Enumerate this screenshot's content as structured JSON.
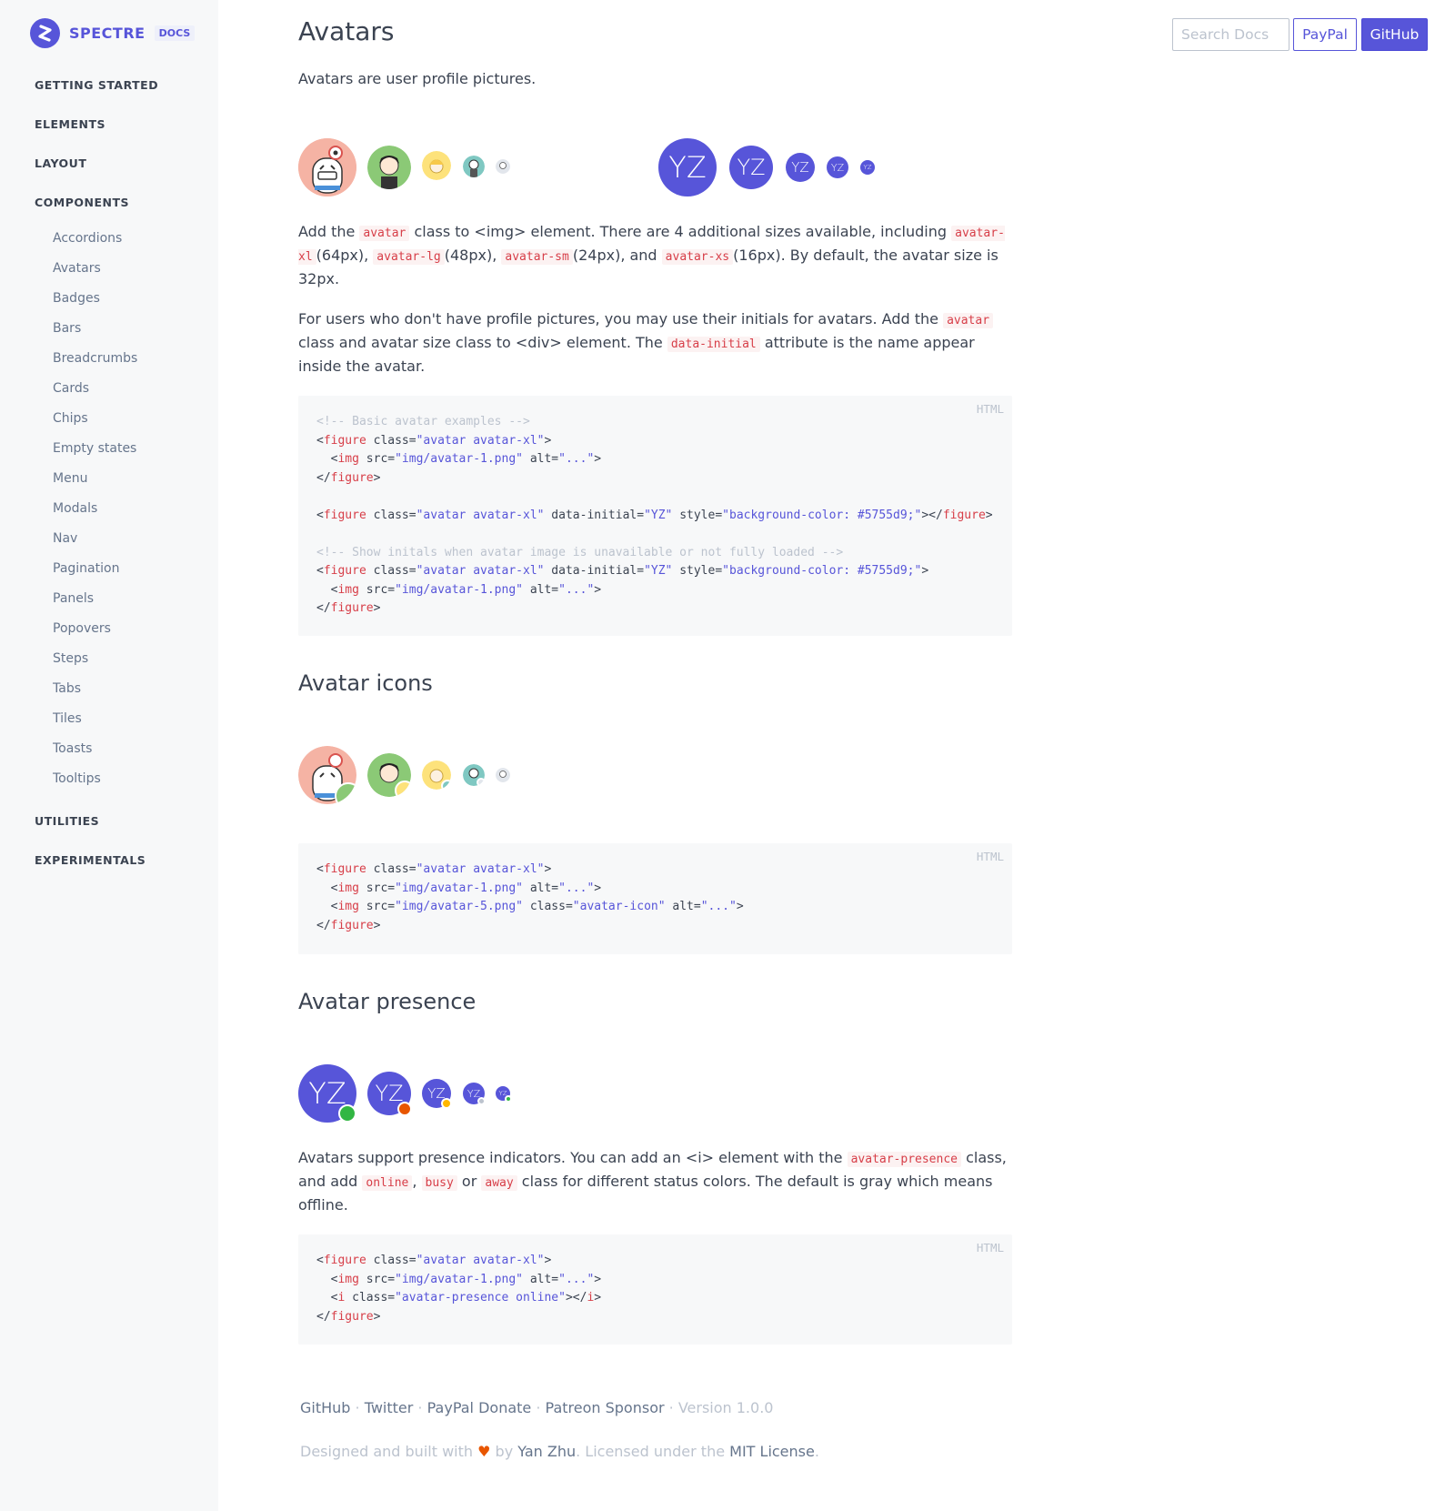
{
  "brand": {
    "name": "SPECTRE",
    "tag": "DOCS"
  },
  "sidebar": {
    "sections": [
      "GETTING STARTED",
      "ELEMENTS",
      "LAYOUT",
      "COMPONENTS",
      "UTILITIES",
      "EXPERIMENTALS"
    ],
    "components": [
      "Accordions",
      "Avatars",
      "Badges",
      "Bars",
      "Breadcrumbs",
      "Cards",
      "Chips",
      "Empty states",
      "Menu",
      "Modals",
      "Nav",
      "Pagination",
      "Panels",
      "Popovers",
      "Steps",
      "Tabs",
      "Tiles",
      "Toasts",
      "Tooltips"
    ]
  },
  "header": {
    "search_placeholder": "Search Docs",
    "paypal": "PayPal",
    "github": "GitHub"
  },
  "page": {
    "title": "Avatars",
    "intro": "Avatars are user profile pictures.",
    "initials": "YZ",
    "p1": {
      "a": "Add the ",
      "c1": "avatar",
      "b": " class to <img> element. There are 4 additional sizes available, including ",
      "c2": "avatar-xl",
      "d": "(64px), ",
      "c3": "avatar-lg",
      "e": "(48px), ",
      "c4": "avatar-sm",
      "f": "(24px), and ",
      "c5": "avatar-xs",
      "g": "(16px). By default, the avatar size is 32px."
    },
    "p2": {
      "a": "For users who don't have profile pictures, you may use their initials for avatars. Add the ",
      "c1": "avatar",
      "b": " class and avatar size class to <div> element. The ",
      "c2": "data-initial",
      "c": " attribute is the name appear inside the avatar."
    },
    "code_lang": "HTML",
    "h_icons": "Avatar icons",
    "h_presence": "Avatar presence",
    "p3": {
      "a": "Avatars support presence indicators. You can add an <i> element with the ",
      "c1": "avatar-presence",
      "b": " class, and add ",
      "c2": "online",
      "sep": ", ",
      "c3": "busy",
      "or": " or ",
      "c4": "away",
      "c": " class for different status colors. The default is gray which means offline."
    }
  },
  "footer": {
    "links": [
      "GitHub",
      "Twitter",
      "PayPal Donate",
      "Patreon Sponsor"
    ],
    "version": "Version 1.0.0",
    "designed": "Designed and built with",
    "heart": "♥",
    "by": "by",
    "author": "Yan Zhu",
    "licensed": ". Licensed under the",
    "license": "MIT License",
    "end": "."
  },
  "colors": {
    "primary": "#5755d9",
    "online": "#32b643",
    "busy": "#e85600",
    "away": "#ffb700",
    "offline": "#bcc3ce"
  }
}
